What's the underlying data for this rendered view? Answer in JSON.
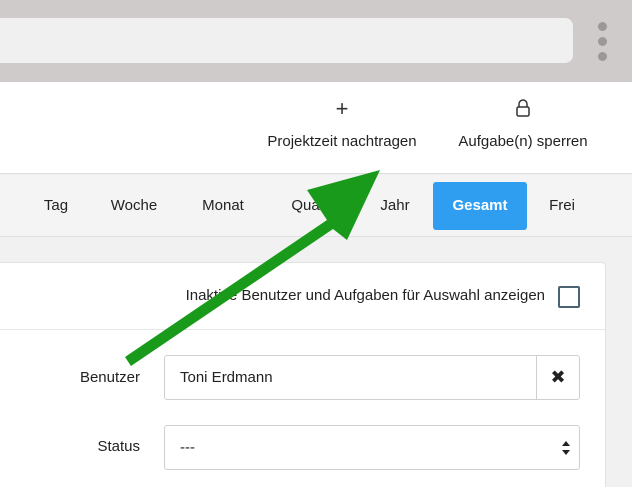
{
  "toolbar": {
    "add_time": {
      "icon": "plus-icon",
      "label": "Projektzeit nachtragen"
    },
    "lock_tasks": {
      "icon": "lock-icon",
      "label": "Aufgabe(n) sperren"
    }
  },
  "period_tabs": {
    "items": [
      {
        "label": "Tag",
        "active": false
      },
      {
        "label": "Woche",
        "active": false
      },
      {
        "label": "Monat",
        "active": false
      },
      {
        "label": "Quartal",
        "active": false
      },
      {
        "label": "Jahr",
        "active": false
      },
      {
        "label": "Gesamt",
        "active": true
      },
      {
        "label": "Frei",
        "active": false
      }
    ],
    "active_color": "#2f9df0"
  },
  "filters": {
    "show_inactive_label": "Inaktive Benutzer und Aufgaben für Auswahl anzeigen",
    "show_inactive_checked": false,
    "user_label": "Benutzer",
    "user_value": "Toni Erdmann",
    "clear_icon": "close-icon",
    "status_label": "Status",
    "status_value": "---"
  },
  "annotation": {
    "arrow_color": "#1a9a1a"
  },
  "browser": {
    "menu_icon": "vertical-dots-icon"
  }
}
